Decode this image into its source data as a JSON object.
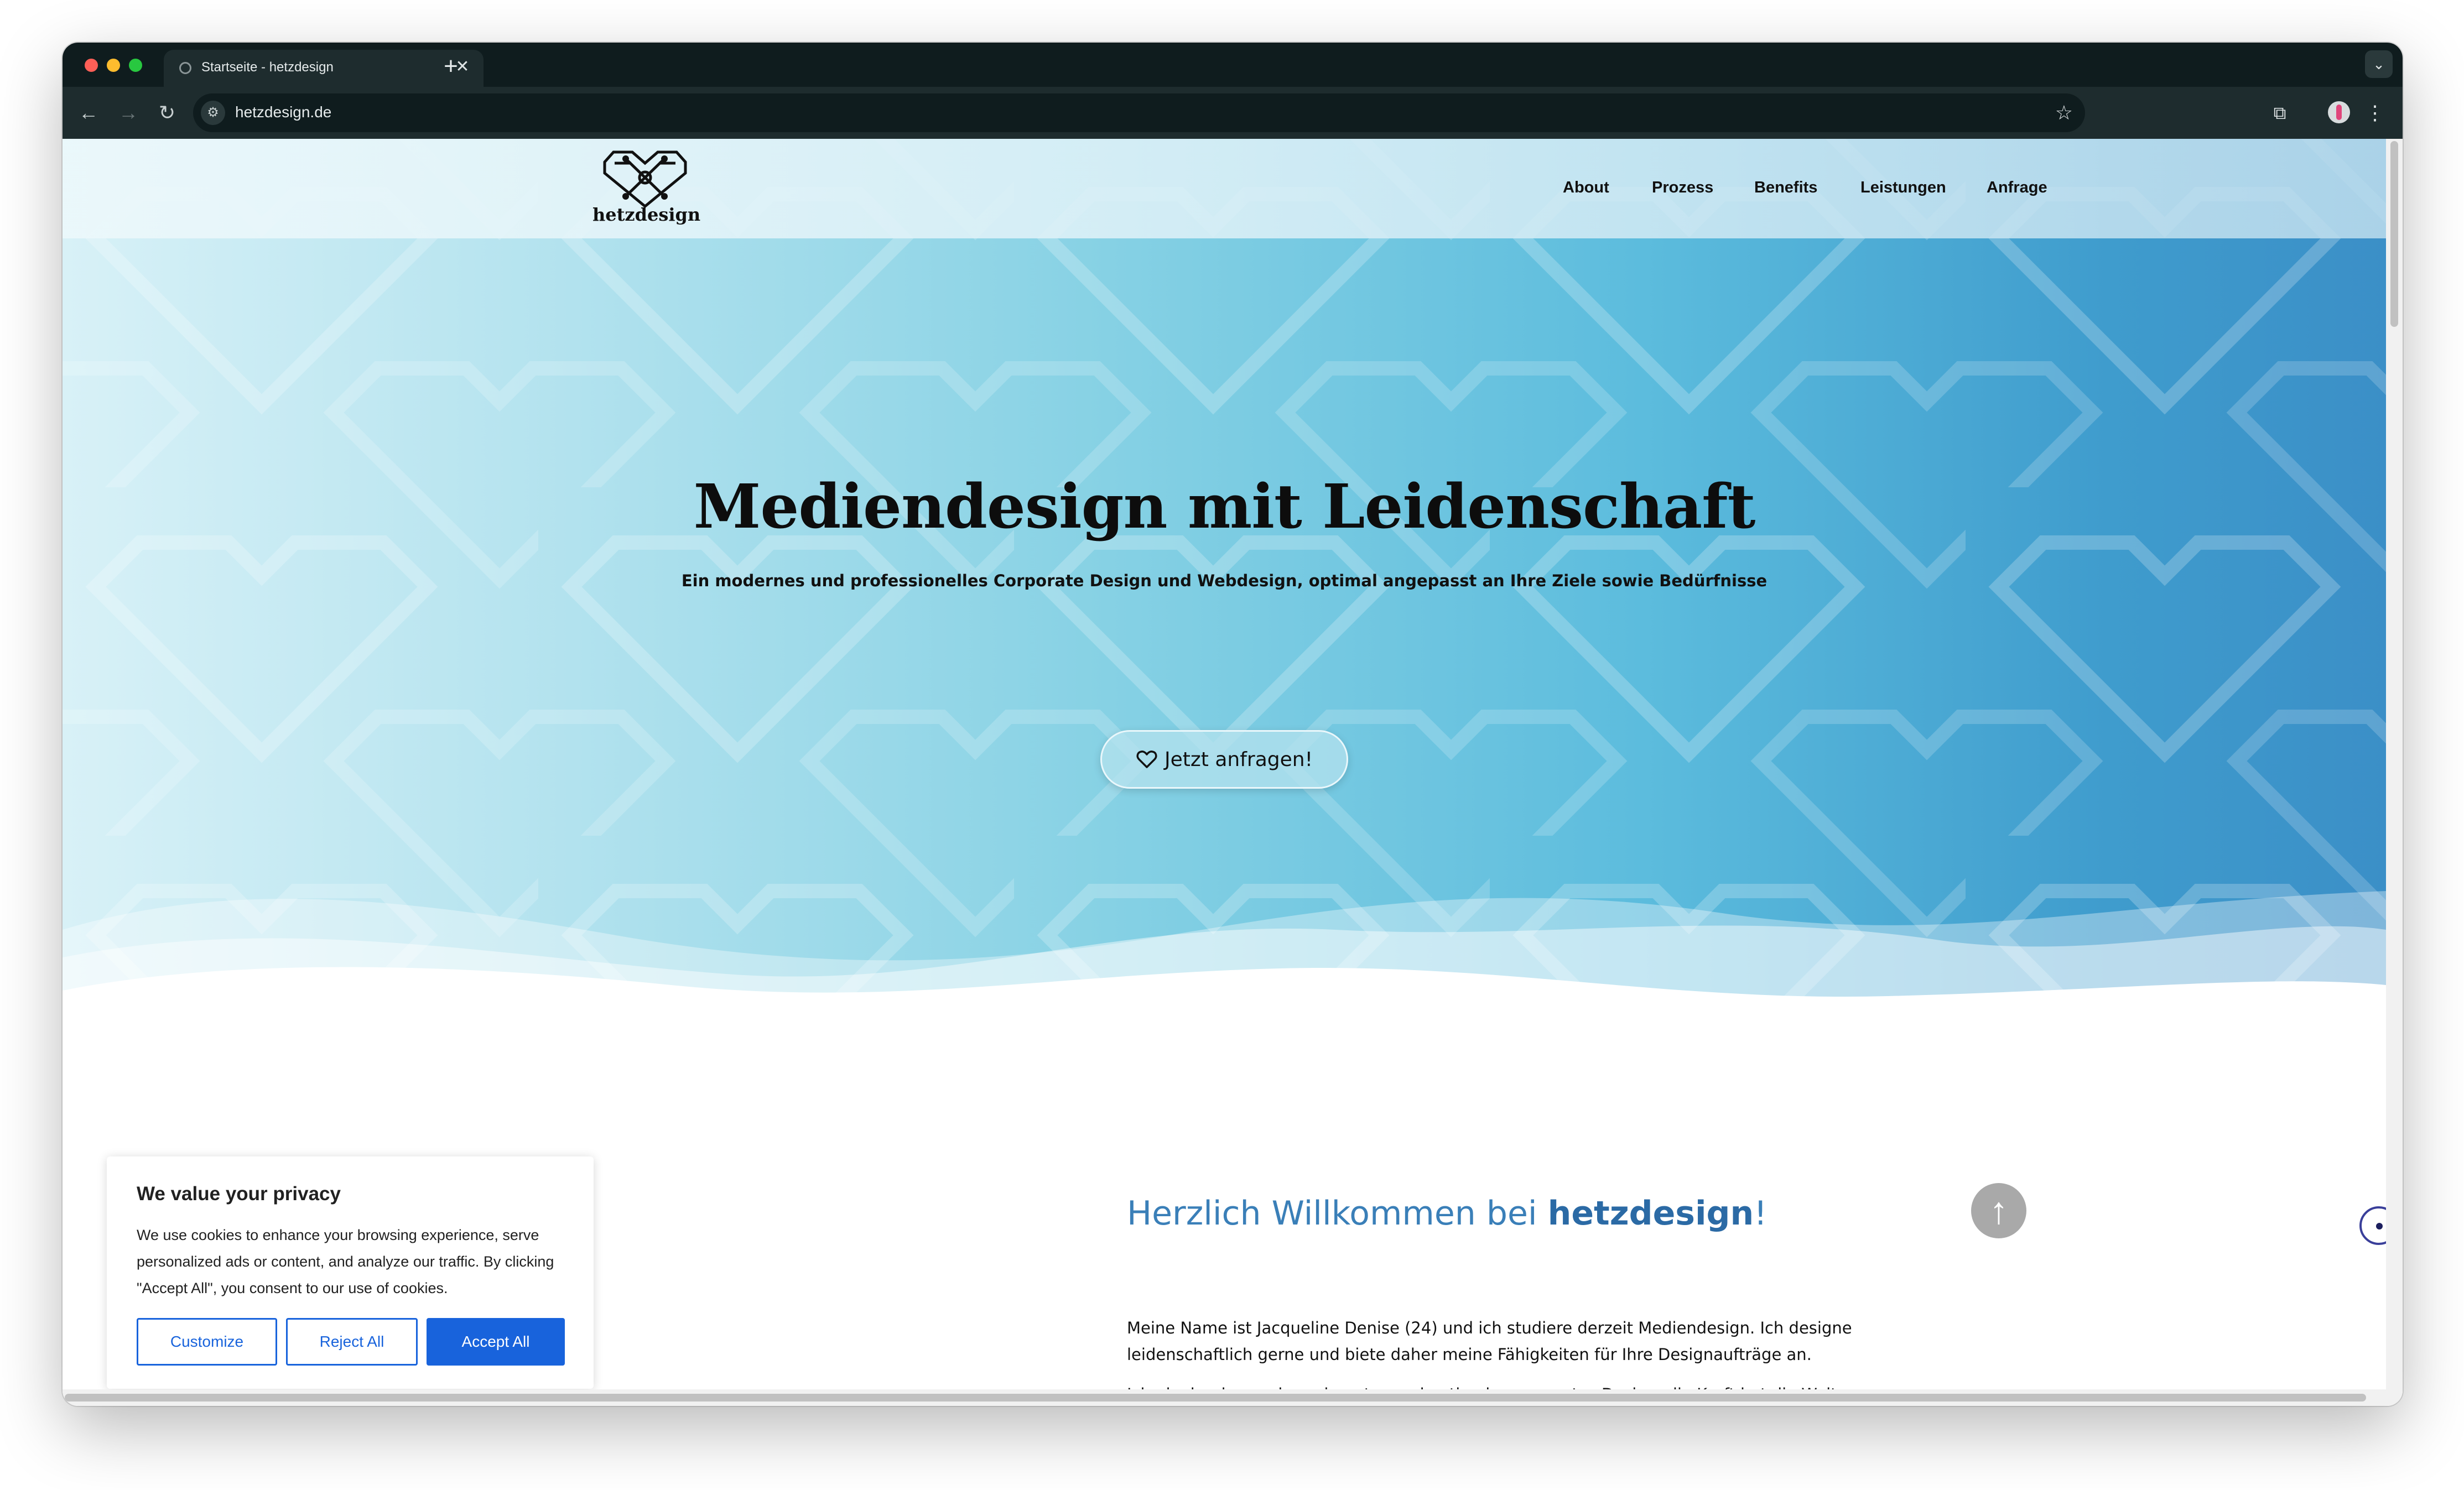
{
  "browser": {
    "tab_title": "Startseite - hetzdesign",
    "tab_close": "✕",
    "new_tab": "+",
    "url": "hetzdesign.de",
    "icons": [
      "back-icon",
      "forward-icon",
      "reload-icon",
      "site-info-icon",
      "bookmark-star-icon",
      "extensions-icon",
      "profile-icon",
      "menu-icon"
    ]
  },
  "site": {
    "logo_text": "hetzdesign",
    "nav": [
      "About",
      "Prozess",
      "Benefits",
      "Leistungen",
      "Anfrage"
    ]
  },
  "hero": {
    "title": "Mediendesign mit Leidenschaft",
    "subtitle": "Ein modernes und professionelles Corporate Design und Webdesign, optimal angepasst an Ihre Ziele sowie Bedürfnisse",
    "cta_label": "Jetzt anfragen!"
  },
  "welcome": {
    "title_prefix": "Herzlich Willkommen bei ",
    "title_brand": "hetzdesign",
    "title_suffix": "!",
    "para1": "Meine Name ist Jacqueline Denise (24) und ich studiere derzeit Mediendesign. Ich designe leidenschaftlich gerne und biete daher meine Fähigkeiten für Ihre Designaufträge an.",
    "para2": "Ich glaube daran, dass ein gutes und optimal angepasstes Design, die Kraft hat die Welt"
  },
  "cookie": {
    "title": "We value your privacy",
    "text": "We use cookies to enhance your browsing experience, serve personalized ads or content, and analyze our traffic. By clicking \"Accept All\", you consent to our use of cookies.",
    "customize": "Customize",
    "reject": "Reject All",
    "accept": "Accept All"
  },
  "colors": {
    "accent_blue": "#1863dc",
    "heading_blue": "#3a7fb8",
    "hero_left": "#d8f1f7",
    "hero_right": "#3b8fc7"
  }
}
